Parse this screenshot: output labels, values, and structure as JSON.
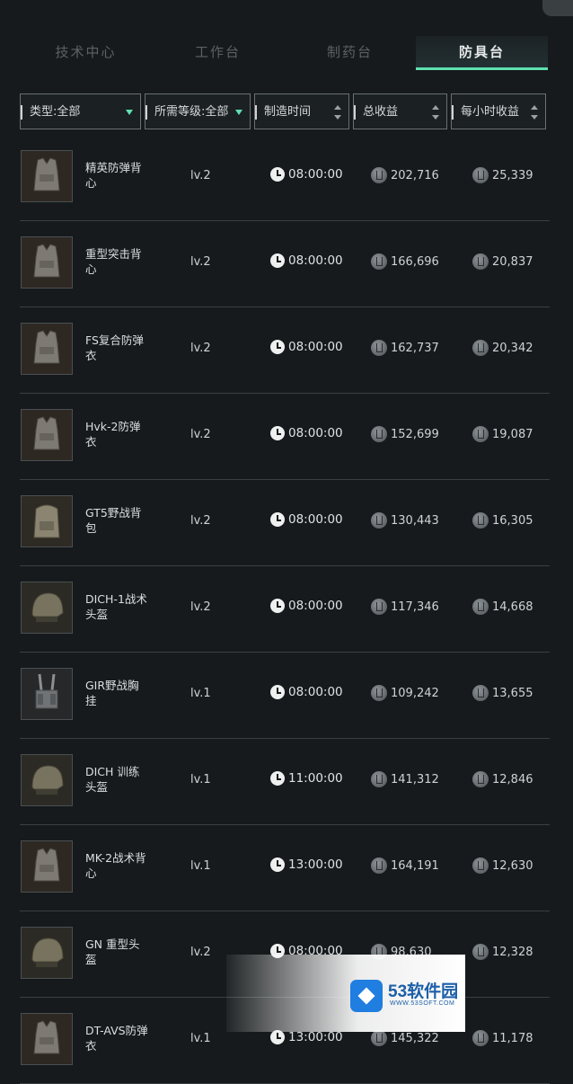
{
  "tabs": [
    {
      "label": "技术中心",
      "active": false
    },
    {
      "label": "工作台",
      "active": false
    },
    {
      "label": "制药台",
      "active": false
    },
    {
      "label": "防具台",
      "active": true
    }
  ],
  "filters": {
    "type": "类型:全部",
    "level": "所需等级:全部",
    "time": "制造时间",
    "total": "总收益",
    "hourly": "每小时收益"
  },
  "items": [
    {
      "name": "精英防弹背心",
      "level": "lv.2",
      "time": "08:00:00",
      "total": "202,716",
      "hourly": "25,339",
      "icon": "vest-icon"
    },
    {
      "name": "重型突击背心",
      "level": "lv.2",
      "time": "08:00:00",
      "total": "166,696",
      "hourly": "20,837",
      "icon": "vest-icon"
    },
    {
      "name": "FS复合防弹衣",
      "level": "lv.2",
      "time": "08:00:00",
      "total": "162,737",
      "hourly": "20,342",
      "icon": "vest-icon"
    },
    {
      "name": "Hvk-2防弹衣",
      "level": "lv.2",
      "time": "08:00:00",
      "total": "152,699",
      "hourly": "19,087",
      "icon": "vest-icon"
    },
    {
      "name": "GT5野战背包",
      "level": "lv.2",
      "time": "08:00:00",
      "total": "130,443",
      "hourly": "16,305",
      "icon": "backpack-icon"
    },
    {
      "name": "DICH-1战术头盔",
      "level": "lv.2",
      "time": "08:00:00",
      "total": "117,346",
      "hourly": "14,668",
      "icon": "helmet-icon"
    },
    {
      "name": "GIR野战胸挂",
      "level": "lv.1",
      "time": "08:00:00",
      "total": "109,242",
      "hourly": "13,655",
      "icon": "chest-rig-icon"
    },
    {
      "name": "DICH 训练头盔",
      "level": "lv.1",
      "time": "11:00:00",
      "total": "141,312",
      "hourly": "12,846",
      "icon": "helmet-icon"
    },
    {
      "name": "MK-2战术背心",
      "level": "lv.1",
      "time": "13:00:00",
      "total": "164,191",
      "hourly": "12,630",
      "icon": "vest-icon"
    },
    {
      "name": "GN 重型头盔",
      "level": "lv.2",
      "time": "08:00:00",
      "total": "98,630",
      "hourly": "12,328",
      "icon": "helmet-icon"
    },
    {
      "name": "DT-AVS防弹衣",
      "level": "lv.1",
      "time": "13:00:00",
      "total": "145,322",
      "hourly": "11,178",
      "icon": "vest-icon"
    }
  ],
  "watermark": {
    "title": "53软件园",
    "url": "WWW.53SOFT.COM"
  },
  "colors": {
    "accent": "#5fe0b0",
    "background": "#161a1c",
    "divider": "#3a3f42"
  }
}
